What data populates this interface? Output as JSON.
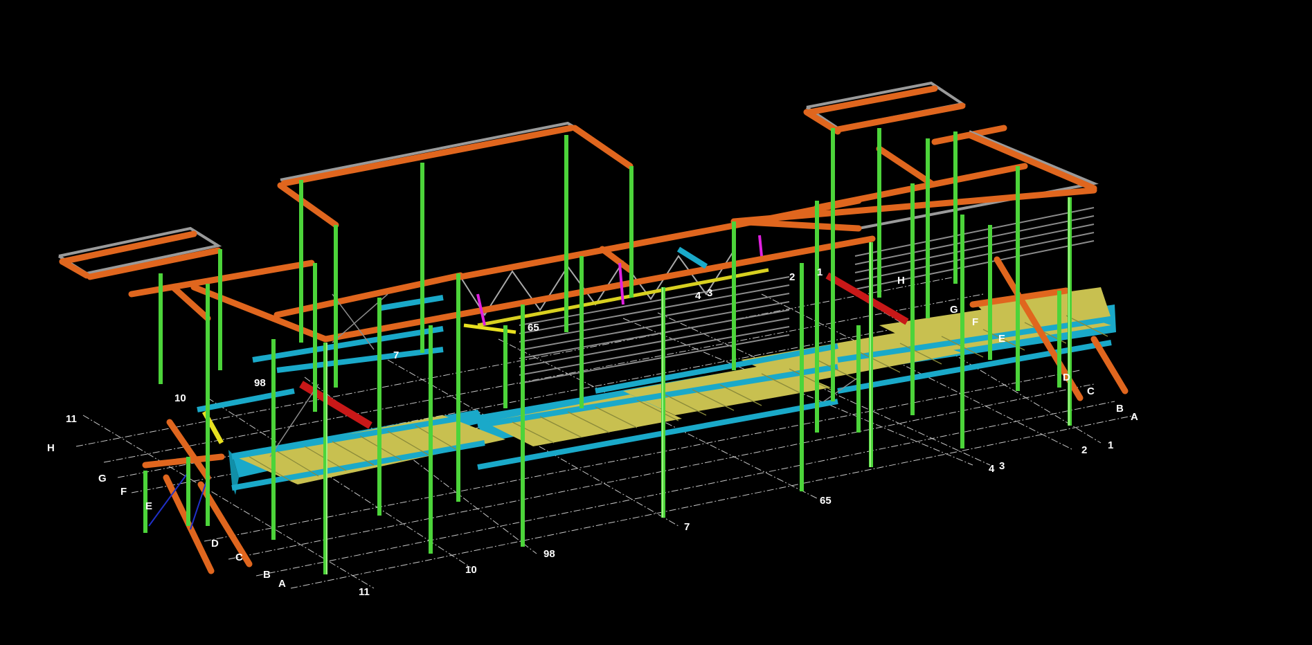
{
  "colors": {
    "background": "#000000",
    "beam": "#e0661e",
    "column": "#4cd43a",
    "deck_frame": "#1aa9c9",
    "decking": "#c8c050",
    "brace_red": "#c81818",
    "brace_yellow": "#e8e020",
    "purlin": "#9a9a9a",
    "accent_magenta": "#e020e0",
    "grid_line": "#c8c8c8"
  },
  "grid_labels": {
    "front_left_letters": [
      "H",
      "G",
      "F",
      "E",
      "D",
      "C",
      "B",
      "A"
    ],
    "front_numbers": [
      "11",
      "10",
      "98",
      "7",
      "65",
      "4",
      "3",
      "2",
      "1"
    ],
    "top_left_numbers": [
      "11",
      "10",
      "98",
      "7"
    ],
    "upper_numbers": [
      "65",
      "4",
      "3",
      "2",
      "1"
    ],
    "right_letters": [
      "H",
      "G",
      "F",
      "E",
      "D",
      "C",
      "B",
      "A"
    ]
  }
}
